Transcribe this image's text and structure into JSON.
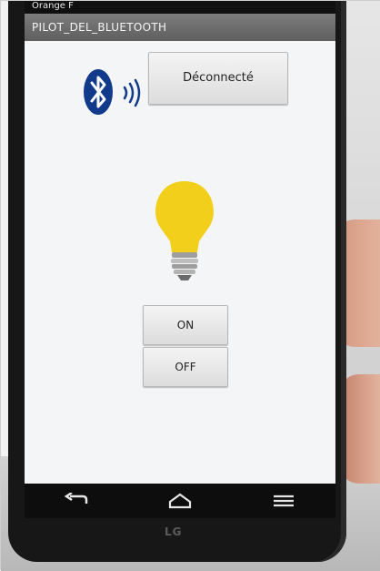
{
  "status_bar": {
    "carrier": "Orange F"
  },
  "app": {
    "title": "PILOT_DEL_BLUETOOTH"
  },
  "connection": {
    "button_label": "Déconnecté"
  },
  "controls": {
    "on_label": "ON",
    "off_label": "OFF"
  },
  "device": {
    "brand": "LG"
  },
  "icons": {
    "bluetooth": "bluetooth-icon",
    "signal": "signal-waves-icon",
    "bulb": "light-bulb-icon",
    "back": "back-icon",
    "home": "home-icon",
    "menu": "menu-icon"
  },
  "colors": {
    "bluetooth_blue": "#123a8a",
    "bulb_yellow": "#f2cf1a",
    "title_bar": "#6a6a6a"
  }
}
